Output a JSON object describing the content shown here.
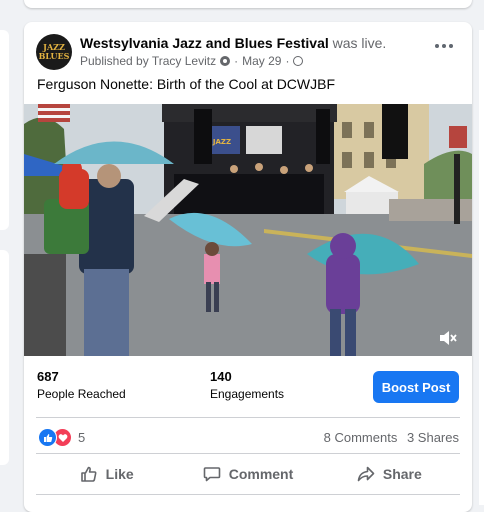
{
  "post": {
    "page_name": "Westsylvania Jazz and Blues Festival",
    "status_suffix": "was live.",
    "published_by": "Published by Tracy Levitz",
    "date": "May 29",
    "separator": "·",
    "avatar_text_line1": "JAZZ",
    "avatar_text_line2": "BLUES",
    "text": "Ferguson Nonette: Birth of the Cool at DCWJBF"
  },
  "video": {
    "stage_banner": "JAZZ BLUES",
    "muted": true
  },
  "insights": {
    "people_reached_value": "687",
    "people_reached_label": "People Reached",
    "engagements_value": "140",
    "engagements_label": "Engagements",
    "boost_label": "Boost Post"
  },
  "reactions": {
    "count": "5",
    "types": [
      "like-icon",
      "love-icon"
    ],
    "comments": "8 Comments",
    "shares": "3 Shares"
  },
  "actions": {
    "like": "Like",
    "comment": "Comment",
    "share": "Share"
  },
  "colors": {
    "accent": "#1877f2",
    "love": "#f33e58",
    "secondary_text": "#65676b"
  }
}
